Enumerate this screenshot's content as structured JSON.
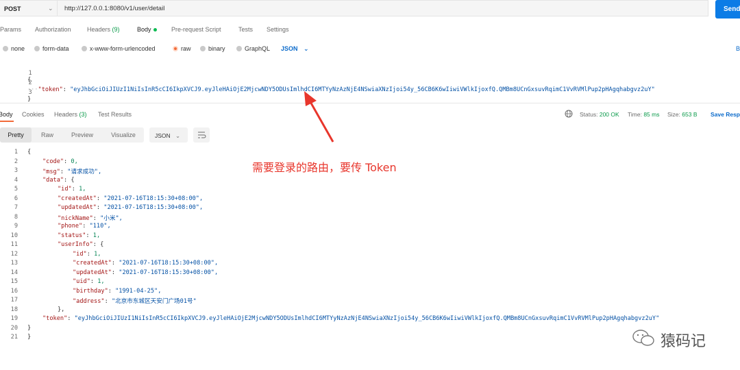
{
  "request": {
    "method": "POST",
    "url": "http://127.0.0.1:8080/v1/user/detail",
    "send_label": "Send"
  },
  "request_tabs": [
    {
      "label": "Params"
    },
    {
      "label": "Authorization"
    },
    {
      "label": "Headers",
      "count": "(9)"
    },
    {
      "label": "Body"
    },
    {
      "label": "Pre-request Script"
    },
    {
      "label": "Tests"
    },
    {
      "label": "Settings"
    }
  ],
  "body_types": [
    {
      "label": "none"
    },
    {
      "label": "form-data"
    },
    {
      "label": "x-www-form-urlencoded"
    },
    {
      "label": "raw"
    },
    {
      "label": "binary"
    },
    {
      "label": "GraphQL"
    }
  ],
  "body_format": "JSON",
  "beautify_label": "B",
  "request_body": {
    "line_numbers": [
      "1",
      "2",
      "3"
    ],
    "brace_open": "{",
    "brace_close": "}",
    "token_key": "\"token\"",
    "token_value": "\"eyJhbGciOiJIUzI1NiIsInR5cCI6IkpXVCJ9.eyJleHAiOjE2MjcwNDY5ODUsImlhdCI6MTYyNzAzNjE4NSwiaXNzIjoi54y_56CB6K6wIiwiVWlkIjoxfQ.QMBm8UCnGxsuvRqimC1VvRVMlPup2pHAgqhabgvz2uY\""
  },
  "response_tabs": [
    {
      "label": "Body"
    },
    {
      "label": "Cookies"
    },
    {
      "label": "Headers",
      "count": "(3)"
    },
    {
      "label": "Test Results"
    }
  ],
  "response_status": {
    "status_label": "Status:",
    "status_value": "200 OK",
    "time_label": "Time:",
    "time_value": "85 ms",
    "size_label": "Size:",
    "size_value": "653 B",
    "save_label": "Save Resp"
  },
  "view_modes": [
    {
      "label": "Pretty"
    },
    {
      "label": "Raw"
    },
    {
      "label": "Preview"
    },
    {
      "label": "Visualize"
    }
  ],
  "response_format": "JSON",
  "response_body": {
    "lines": [
      {
        "n": "1",
        "k": "",
        "v": "",
        "raw": "{"
      },
      {
        "n": "2",
        "k": "\"code\"",
        "v": "0,",
        "vt": "num"
      },
      {
        "n": "3",
        "k": "\"msg\"",
        "v": "\"请求成功\",",
        "vt": "str"
      },
      {
        "n": "4",
        "k": "\"data\"",
        "v": "{",
        "vt": "plain"
      },
      {
        "n": "5",
        "k": "\"id\"",
        "v": "1,",
        "vt": "num"
      },
      {
        "n": "6",
        "k": "\"createdAt\"",
        "v": "\"2021-07-16T18:15:30+08:00\",",
        "vt": "str"
      },
      {
        "n": "7",
        "k": "\"updatedAt\"",
        "v": "\"2021-07-16T18:15:30+08:00\",",
        "vt": "str"
      },
      {
        "n": "8",
        "k": "\"nickName\"",
        "v": "\"小米\",",
        "vt": "str"
      },
      {
        "n": "9",
        "k": "\"phone\"",
        "v": "\"110\",",
        "vt": "str"
      },
      {
        "n": "10",
        "k": "\"status\"",
        "v": "1,",
        "vt": "num"
      },
      {
        "n": "11",
        "k": "\"userInfo\"",
        "v": "{",
        "vt": "plain"
      },
      {
        "n": "12",
        "k": "\"id\"",
        "v": "1,",
        "vt": "num"
      },
      {
        "n": "13",
        "k": "\"createdAt\"",
        "v": "\"2021-07-16T18:15:30+08:00\",",
        "vt": "str"
      },
      {
        "n": "14",
        "k": "\"updatedAt\"",
        "v": "\"2021-07-16T18:15:30+08:00\",",
        "vt": "str"
      },
      {
        "n": "15",
        "k": "\"uid\"",
        "v": "1,",
        "vt": "num"
      },
      {
        "n": "16",
        "k": "\"birthday\"",
        "v": "\"1991-04-25\",",
        "vt": "str"
      },
      {
        "n": "17",
        "k": "\"address\"",
        "v": "\"北京市东城区天安门广场01号\"",
        "vt": "str"
      },
      {
        "n": "18",
        "k": "",
        "v": "",
        "raw": "},"
      },
      {
        "n": "19",
        "k": "\"token\"",
        "v": "\"eyJhbGciOiJIUzI1NiIsInR5cCI6IkpXVCJ9.eyJleHAiOjE2MjcwNDY5ODUsImlhdCI6MTYyNzAzNjE4NSwiaXNzIjoi54y_56CB6K6wIiwiVWlkIjoxfQ.QMBm8UCnGxsuvRqimC1VvRVMlPup2pHAgqhabgvz2uY\"",
        "vt": "str"
      },
      {
        "n": "20",
        "k": "",
        "v": "",
        "raw": "}"
      },
      {
        "n": "21",
        "k": "",
        "v": "",
        "raw": "}"
      }
    ]
  },
  "annotation": "需要登录的路由，要传 Token",
  "watermark": "猿码记",
  "colors": {
    "accent_orange": "#f26b3a",
    "send_blue": "#0c7ce6",
    "status_green": "#0a9a4a",
    "annotation_red": "#e8362c"
  }
}
